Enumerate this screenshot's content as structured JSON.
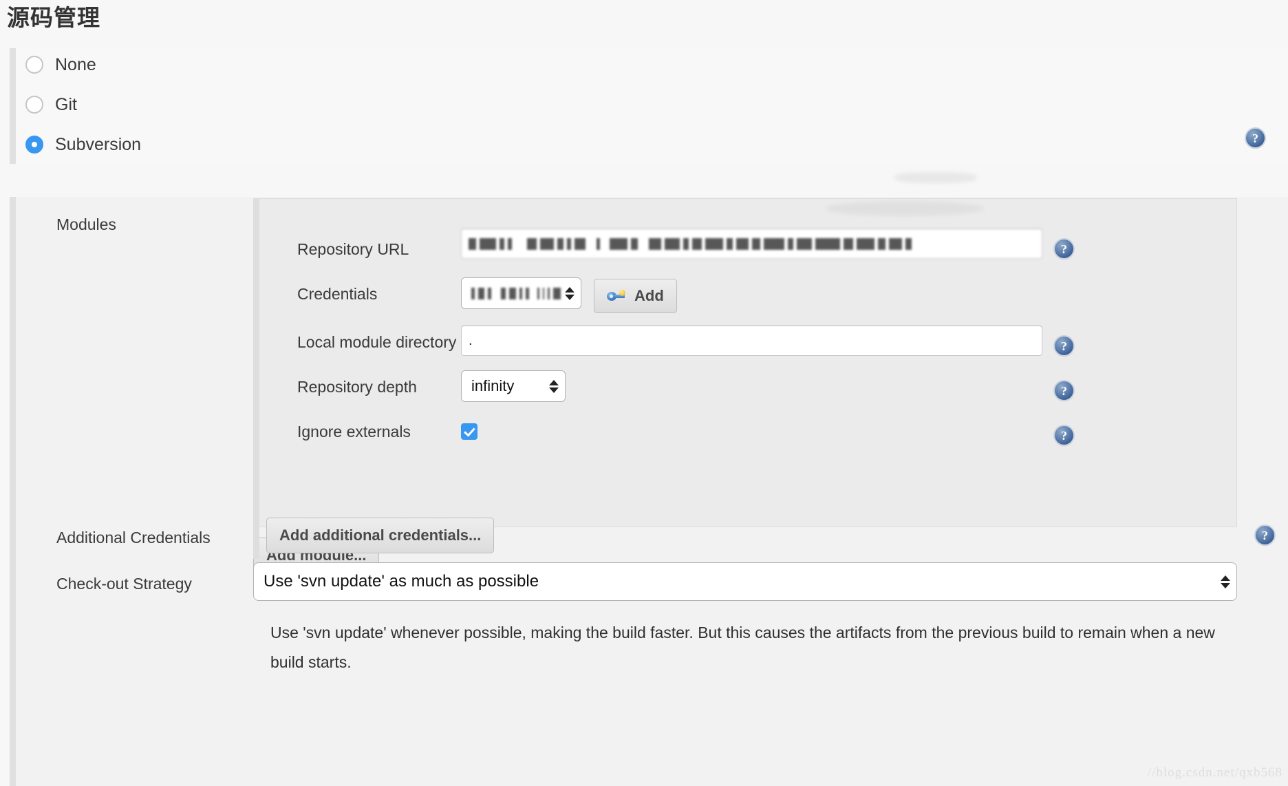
{
  "page": {
    "title": "源码管理",
    "watermark": "//blog.csdn.net/qxb568"
  },
  "scm": {
    "options": [
      {
        "label": "None",
        "selected": false
      },
      {
        "label": "Git",
        "selected": false
      },
      {
        "label": "Subversion",
        "selected": true
      }
    ],
    "help_icon": "?"
  },
  "modules": {
    "label": "Modules",
    "fields": {
      "repository_url": {
        "label": "Repository URL",
        "value": "",
        "redacted": true,
        "help_icon": "?"
      },
      "credentials": {
        "label": "Credentials",
        "value": "",
        "redacted": true,
        "add_button_label": "Add",
        "add_button_icon": "key-icon"
      },
      "local_module_directory": {
        "label": "Local module directory",
        "value": ".",
        "help_icon": "?"
      },
      "repository_depth": {
        "label": "Repository depth",
        "value": "infinity",
        "help_icon": "?"
      },
      "ignore_externals": {
        "label": "Ignore externals",
        "checked": true,
        "help_icon": "?"
      }
    },
    "add_module_button": "Add module..."
  },
  "additional_credentials": {
    "label": "Additional Credentials",
    "button": "Add additional credentials...",
    "help_icon": "?"
  },
  "checkout_strategy": {
    "label": "Check-out Strategy",
    "value": "Use 'svn update' as much as possible",
    "description": "Use 'svn update' whenever possible, making the build faster. But this causes the artifacts from the previous build to remain when a new build starts."
  }
}
